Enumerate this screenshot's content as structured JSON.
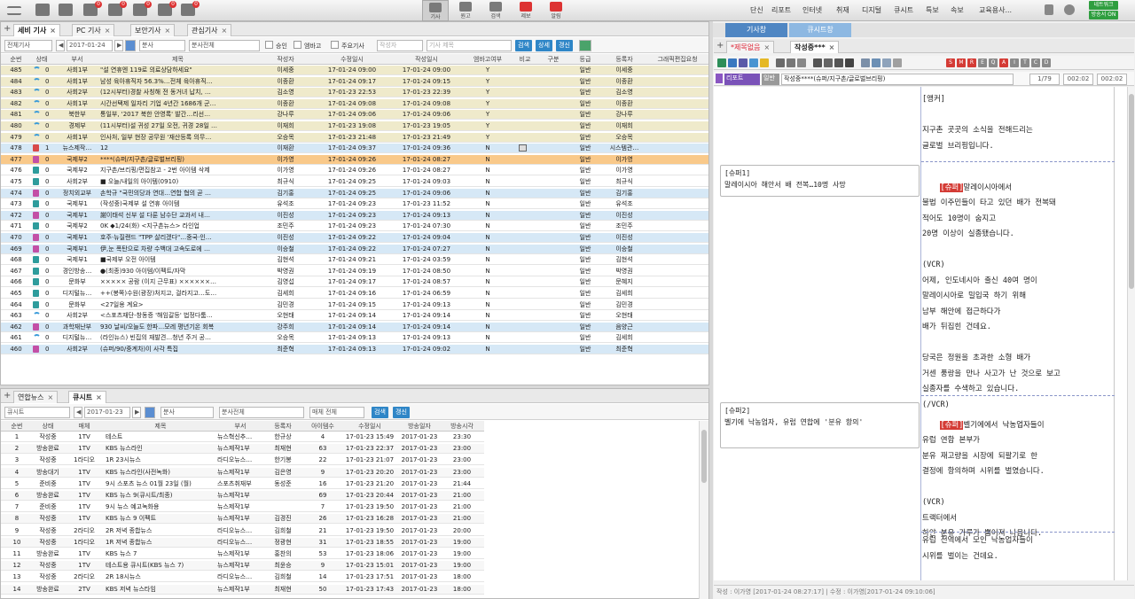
{
  "topbar": {
    "buttons": [
      {
        "icon": "program-icon",
        "label": "기사"
      },
      {
        "icon": "edit-icon",
        "label": "원고"
      },
      {
        "icon": "search-icon",
        "label": "검색"
      },
      {
        "icon": "alert-icon",
        "label": "제보",
        "badge": "0"
      },
      {
        "icon": "message-icon",
        "label": "알림",
        "badge": "0"
      }
    ],
    "left_badges": [
      "0",
      "0",
      "0",
      "0",
      "0"
    ],
    "menu": [
      "단신",
      "리포트",
      "인터넷",
      "취재",
      "디지털",
      "큐시트",
      "특보",
      "속보",
      "교육용사..."
    ],
    "status": [
      "네트워크 ON",
      "방송서 ON"
    ]
  },
  "left_top": {
    "tabs": [
      {
        "label": "세비 기사",
        "active": true
      },
      {
        "label": "PC 기사"
      },
      {
        "label": "보안기사"
      },
      {
        "label": "관심기사"
      }
    ],
    "filters": {
      "type": "전체기사",
      "date": "2017-01-24",
      "dept": "분사",
      "dept_all": "분사전체",
      "check_approved": "승인",
      "check_embargo": "엠바고",
      "check_main": "주요기사",
      "writer_placeholder": "작성자",
      "title_placeholder": "기사 제목",
      "btn_search": "검색",
      "btn_detail": "상세",
      "btn_refresh": "갱신"
    },
    "columns": [
      "순번",
      "상태",
      "부서",
      "제목",
      "작성자",
      "수정일시",
      "작성일시",
      "엠바고여부",
      "비교",
      "구분",
      "등급",
      "등록자",
      "그래픽편집요청"
    ],
    "rows": [
      {
        "no": "485",
        "status": "0",
        "dept": "사회1부",
        "title": "\"설 연휴엔 119로 의료상담하세요\"",
        "writer": "이세중",
        "mod": "17-01-24 09:00",
        "created": "17-01-24 09:00",
        "embargo": "Y",
        "grade": "일반",
        "reg": "이세중",
        "color": "yellow",
        "icon": "wifi"
      },
      {
        "no": "484",
        "status": "0",
        "dept": "사회1부",
        "title": "남성 육아휴직자 56.3%…전체 육아휴직…",
        "writer": "이종환",
        "mod": "17-01-24 09:17",
        "created": "17-01-24 09:15",
        "embargo": "Y",
        "grade": "일반",
        "reg": "이종환",
        "color": "yellow",
        "icon": "wifi"
      },
      {
        "no": "483",
        "status": "0",
        "dept": "사회2부",
        "title": "(12시부터)경찰 사칭해 전 동거녀 납치, …",
        "writer": "김소영",
        "mod": "17-01-23 22:53",
        "created": "17-01-23 22:39",
        "embargo": "Y",
        "grade": "일반",
        "reg": "김소영",
        "color": "yellow",
        "icon": "wifi"
      },
      {
        "no": "482",
        "status": "0",
        "dept": "사회1부",
        "title": "시간선택제 일자리 기업 4년간 1686개 군…",
        "writer": "이종환",
        "mod": "17-01-24 09:08",
        "created": "17-01-24 09:08",
        "embargo": "Y",
        "grade": "일반",
        "reg": "이종환",
        "color": "yellow",
        "icon": "wifi"
      },
      {
        "no": "481",
        "status": "0",
        "dept": "북한부",
        "title": "통일부, '2017 북한 안영록' 발간…리선…",
        "writer": "강나루",
        "mod": "17-01-24 09:06",
        "created": "17-01-24 09:06",
        "embargo": "Y",
        "grade": "일반",
        "reg": "강나루",
        "color": "yellow",
        "icon": "wifi"
      },
      {
        "no": "480",
        "status": "0",
        "dept": "경제부",
        "title": "(11시부터)설 귀성 27일 오전, 귀경 28일 …",
        "writer": "이재희",
        "mod": "17-01-23 19:08",
        "created": "17-01-23 19:05",
        "embargo": "Y",
        "grade": "일반",
        "reg": "이재희",
        "color": "yellow",
        "icon": "wifi"
      },
      {
        "no": "479",
        "status": "0",
        "dept": "사회1부",
        "title": "인사처, 일부 현장 공무원 '재산등록 의무…",
        "writer": "오승목",
        "mod": "17-01-23 21:48",
        "created": "17-01-23 21:49",
        "embargo": "Y",
        "grade": "일반",
        "reg": "오승목",
        "color": "yellow",
        "icon": "wifi"
      },
      {
        "no": "478",
        "status": "1",
        "dept": "뉴스제작…",
        "title": "12",
        "writer": "이재환",
        "mod": "17-01-24 09:37",
        "created": "17-01-24 09:36",
        "embargo": "N",
        "grade": "일반",
        "reg": "시스템관…",
        "color": "blue",
        "icon": "doc-red"
      },
      {
        "no": "477",
        "status": "0",
        "dept": "국제부2",
        "title": "****(슈퍼/지구촌/글로벌브리핑)",
        "writer": "이가영",
        "mod": "17-01-24 09:26",
        "created": "17-01-24 08:27",
        "embargo": "N",
        "grade": "일반",
        "reg": "이가영",
        "color": "orange",
        "icon": "doc-pink"
      },
      {
        "no": "476",
        "status": "0",
        "dept": "국제부2",
        "title": "지구촌/브리핑/편집참고 - 2번 아이템 삭제",
        "writer": "이가영",
        "mod": "17-01-24 09:26",
        "created": "17-01-24 08:27",
        "embargo": "N",
        "grade": "일반",
        "reg": "이가영",
        "color": "white",
        "icon": "doc-teal"
      },
      {
        "no": "475",
        "status": "0",
        "dept": "사회2부",
        "title": "■ 오늘/내일의 아이템(0910)",
        "writer": "최규식",
        "mod": "17-01-24 09:25",
        "created": "17-01-24 09:03",
        "embargo": "N",
        "grade": "일반",
        "reg": "최규식",
        "color": "white",
        "icon": "doc-teal"
      },
      {
        "no": "474",
        "status": "0",
        "dept": "정치외교부",
        "title": "손학규 \"국민의당과 연대…연합 협의 곧 …",
        "writer": "김기홍",
        "mod": "17-01-24 09:25",
        "created": "17-01-24 09:06",
        "embargo": "N",
        "grade": "일반",
        "reg": "김기홍",
        "color": "blue",
        "icon": "doc-pink"
      },
      {
        "no": "473",
        "status": "0",
        "dept": "국제부1",
        "title": "(작성중)국제부 설 연휴 아이템",
        "writer": "유석조",
        "mod": "17-01-24 09:23",
        "created": "17-01-23 11:52",
        "embargo": "N",
        "grade": "일반",
        "reg": "유석조",
        "color": "white",
        "icon": "doc-teal"
      },
      {
        "no": "472",
        "status": "0",
        "dept": "국제부1",
        "title": "謝이태석 신부 설 다룬 남수단 교과서 내…",
        "writer": "이진성",
        "mod": "17-01-24 09:23",
        "created": "17-01-24 09:13",
        "embargo": "N",
        "grade": "일반",
        "reg": "이진성",
        "color": "blue",
        "icon": "doc-pink"
      },
      {
        "no": "471",
        "status": "0",
        "dept": "국제부2",
        "title": "0K ◆1/24(화) <지구촌뉴스> 라인업",
        "writer": "조민주",
        "mod": "17-01-24 09:23",
        "created": "17-01-24 07:30",
        "embargo": "N",
        "grade": "일반",
        "reg": "조민주",
        "color": "white",
        "icon": "doc-teal"
      },
      {
        "no": "470",
        "status": "0",
        "dept": "국제부1",
        "title": "호주·뉴질랜드 \"TPP 살리겠다\"…중국·인…",
        "writer": "이진성",
        "mod": "17-01-24 09:22",
        "created": "17-01-24 09:04",
        "embargo": "N",
        "grade": "일반",
        "reg": "이진성",
        "color": "blue",
        "icon": "doc-pink"
      },
      {
        "no": "469",
        "status": "0",
        "dept": "국제부1",
        "title": "伊,눈 폭탄으로 차량 수백대 고속도로에 …",
        "writer": "이승철",
        "mod": "17-01-24 09:22",
        "created": "17-01-24 07:27",
        "embargo": "N",
        "grade": "일반",
        "reg": "이승철",
        "color": "blue",
        "icon": "doc-pink"
      },
      {
        "no": "468",
        "status": "0",
        "dept": "국제부1",
        "title": "■국제부 오전 아이템",
        "writer": "김현석",
        "mod": "17-01-24 09:21",
        "created": "17-01-24 03:59",
        "embargo": "N",
        "grade": "일반",
        "reg": "김현석",
        "color": "white",
        "icon": "doc-teal"
      },
      {
        "no": "467",
        "status": "0",
        "dept": "경인방송…",
        "title": "●(최종)930 아이템/이펙트/자막",
        "writer": "박영권",
        "mod": "17-01-24 09:19",
        "created": "17-01-24 08:50",
        "embargo": "N",
        "grade": "일반",
        "reg": "박영권",
        "color": "white",
        "icon": "doc-teal"
      },
      {
        "no": "466",
        "status": "0",
        "dept": "문화부",
        "title": "××××× 공람 (이지 근무표) ××××××…",
        "writer": "김영섭",
        "mod": "17-01-24 09:17",
        "created": "17-01-24 08:57",
        "embargo": "N",
        "grade": "일반",
        "reg": "문혜지",
        "color": "white",
        "icon": "doc-teal"
      },
      {
        "no": "465",
        "status": "0",
        "dept": "디지털뉴…",
        "title": "++(봉쪽)수원(광장)처지고, 걸라지고…도…",
        "writer": "김세희",
        "mod": "17-01-24 09:16",
        "created": "17-01-24 06:59",
        "embargo": "N",
        "grade": "일반",
        "reg": "김세희",
        "color": "white",
        "icon": "doc-teal"
      },
      {
        "no": "464",
        "status": "0",
        "dept": "문화부",
        "title": "<27일용 계요>",
        "writer": "김민경",
        "mod": "17-01-24 09:15",
        "created": "17-01-24 09:13",
        "embargo": "N",
        "grade": "일반",
        "reg": "김민경",
        "color": "white",
        "icon": "doc-teal"
      },
      {
        "no": "463",
        "status": "0",
        "dept": "사회2부",
        "title": "<스포츠재단-창동증 '해임갈등' 법정다툼…",
        "writer": "오현태",
        "mod": "17-01-24 09:14",
        "created": "17-01-24 09:14",
        "embargo": "N",
        "grade": "일반",
        "reg": "오현태",
        "color": "white",
        "icon": "wifi"
      },
      {
        "no": "462",
        "status": "0",
        "dept": "과학재난부",
        "title": "930 날씨/오늘도 한파…모레 평년기온 회복",
        "writer": "강주희",
        "mod": "17-01-24 09:14",
        "created": "17-01-24 09:14",
        "embargo": "N",
        "grade": "일반",
        "reg": "음양근",
        "color": "blue",
        "icon": "doc-pink"
      },
      {
        "no": "461",
        "status": "0",
        "dept": "디지털뉴…",
        "title": "(라인뉴스) 빈집의 재발견…청년 주거 공…",
        "writer": "오승목",
        "mod": "17-01-24 09:13",
        "created": "17-01-24 09:13",
        "embargo": "N",
        "grade": "일반",
        "reg": "김세희",
        "color": "white",
        "icon": "wifi"
      },
      {
        "no": "460",
        "status": "0",
        "dept": "사회2부",
        "title": "(슈퍼/90/중계차)이 사각 특집",
        "writer": "최준혁",
        "mod": "17-01-24 09:13",
        "created": "17-01-24 09:02",
        "embargo": "N",
        "grade": "일반",
        "reg": "최준혁",
        "color": "blue",
        "icon": "doc-pink"
      }
    ]
  },
  "left_bottom": {
    "tabs": [
      {
        "label": "연합뉴스"
      },
      {
        "label": "큐시트",
        "active": true
      }
    ],
    "filters": {
      "type": "큐시트",
      "date": "2017-01-23",
      "dept": "분사",
      "dept_all": "분사전체",
      "media": "매체 전체",
      "btn_search": "검색",
      "btn_refresh": "갱신"
    },
    "columns": [
      "순번",
      "상태",
      "매체",
      "제목",
      "부서",
      "등록자",
      "아이템수",
      "수정일시",
      "방송일자",
      "방송시각"
    ],
    "rows": [
      {
        "no": "1",
        "status": "작성중",
        "media": "1TV",
        "title": "테스트",
        "dept": "뉴스혁신추…",
        "reg": "한규상",
        "items": "4",
        "mod": "17-01-23 15:49",
        "date": "2017-01-23",
        "time": "23:30"
      },
      {
        "no": "2",
        "status": "방송완료",
        "media": "1TV",
        "title": "KBS 뉴스라인",
        "dept": "뉴스제작1부",
        "reg": "최재현",
        "items": "63",
        "mod": "17-01-23 22:37",
        "date": "2017-01-23",
        "time": "23:00"
      },
      {
        "no": "3",
        "status": "작성중",
        "media": "1라디오",
        "title": "1R 23시뉴스",
        "dept": "라디오뉴스…",
        "reg": "한기봉",
        "items": "22",
        "mod": "17-01-23 21:07",
        "date": "2017-01-23",
        "time": "23:00"
      },
      {
        "no": "4",
        "status": "방송대기",
        "media": "1TV",
        "title": "KBS 뉴스라인(사전녹화)",
        "dept": "뉴스제작1부",
        "reg": "김은영",
        "items": "9",
        "mod": "17-01-23 20:20",
        "date": "2017-01-23",
        "time": "23:00"
      },
      {
        "no": "5",
        "status": "준비중",
        "media": "1TV",
        "title": "9시 스포츠 뉴스 01월 23일 (월)",
        "dept": "스포츠취재부",
        "reg": "동성준",
        "items": "16",
        "mod": "17-01-23 21:20",
        "date": "2017-01-23",
        "time": "21:44"
      },
      {
        "no": "6",
        "status": "방송완료",
        "media": "1TV",
        "title": "KBS 뉴스 9(큐시트/최종)",
        "dept": "뉴스제작1부",
        "reg": "",
        "items": "69",
        "mod": "17-01-23 20:44",
        "date": "2017-01-23",
        "time": "21:00"
      },
      {
        "no": "7",
        "status": "준비중",
        "media": "1TV",
        "title": "9시 뉴스 예고녹화용",
        "dept": "뉴스제작1부",
        "reg": "",
        "items": "7",
        "mod": "17-01-23 19:50",
        "date": "2017-01-23",
        "time": "21:00"
      },
      {
        "no": "8",
        "status": "작성중",
        "media": "1TV",
        "title": "KBS 뉴스 9 이펙트",
        "dept": "뉴스제작1부",
        "reg": "김경진",
        "items": "26",
        "mod": "17-01-23 16:28",
        "date": "2017-01-23",
        "time": "21:00"
      },
      {
        "no": "9",
        "status": "작성중",
        "media": "2라디오",
        "title": "2R 저녁 종합뉴스",
        "dept": "라디오뉴스…",
        "reg": "김희철",
        "items": "21",
        "mod": "17-01-23 19:50",
        "date": "2017-01-23",
        "time": "20:00"
      },
      {
        "no": "10",
        "status": "작성중",
        "media": "1라디오",
        "title": "1R 저녁 종합뉴스",
        "dept": "라디오뉴스…",
        "reg": "정광현",
        "items": "31",
        "mod": "17-01-23 18:55",
        "date": "2017-01-23",
        "time": "19:00"
      },
      {
        "no": "11",
        "status": "방송완료",
        "media": "1TV",
        "title": "KBS 뉴스 7",
        "dept": "뉴스제작1부",
        "reg": "홍찬의",
        "items": "53",
        "mod": "17-01-23 18:06",
        "date": "2017-01-23",
        "time": "19:00"
      },
      {
        "no": "12",
        "status": "작성중",
        "media": "1TV",
        "title": "테스트용 큐시트(KBS 뉴스 7)",
        "dept": "뉴스제작1부",
        "reg": "최윤승",
        "items": "9",
        "mod": "17-01-23 15:01",
        "date": "2017-01-23",
        "time": "19:00"
      },
      {
        "no": "13",
        "status": "작성중",
        "media": "2라디오",
        "title": "2R 18시뉴스",
        "dept": "라디오뉴스…",
        "reg": "김희철",
        "items": "14",
        "mod": "17-01-23 17:51",
        "date": "2017-01-23",
        "time": "18:00"
      },
      {
        "no": "14",
        "status": "방송완료",
        "media": "2TV",
        "title": "KBS 저녁 뉴스타임",
        "dept": "뉴스제작1부",
        "reg": "최재현",
        "items": "50",
        "mod": "17-01-23 17:43",
        "date": "2017-01-23",
        "time": "18:00"
      }
    ]
  },
  "right": {
    "tabs": [
      "기사창",
      "큐시트창"
    ],
    "doc_tabs": [
      {
        "label": "*제목없음"
      },
      {
        "label": "작성중***",
        "active": true
      }
    ],
    "toolbar_letters": [
      "S",
      "M",
      "R",
      "E",
      "Q",
      "A",
      "I",
      "T",
      "C",
      "D"
    ],
    "info": {
      "type": "리포트",
      "grade": "일반",
      "title": "작성중****(슈퍼/지구촌/글로벌브리핑)",
      "page": "1/79",
      "dur1": "002:02",
      "dur2": "002:02"
    },
    "cues": [
      {
        "text": "[슈퍼1]\n말레이시아 해안서 배 전복…10명 사망"
      },
      {
        "text": "[슈퍼2]\n벨기에 낙농업자, 유럽 연합에 '분유 항의'"
      }
    ],
    "body": {
      "block1": "[앵커]\n\n지구촌 곳곳의 소식을 전해드리는\n글로벌 브리핑입니다.",
      "block2_prefix": "[슈퍼]",
      "block2": "말레이시아에서\n불법 이주민들이 타고 있던 배가 전복돼\n적어도 10명이 숨지고\n20명 이상이 실종됐습니다.\n\n(VCR)\n어제, 인도네시아 출신 40여 명이\n말레이시아로 밀입국 하기 위해\n남부 해안에 접근하다가\n배가 뒤집힌 건데요.\n\n당국은 정원을 초과한 소형 배가\n거센 풍랑을 만나 사고가 난 것으로 보고\n실종자를 수색하고 있습니다.\n(/VCR)",
      "block3_prefix": "[슈퍼]",
      "block3": "벨기에에서 낙농업자들이\n유럽 연합 본부가\n분유 재고량을 시장에 되팔기로 한\n결정에 항의하며 시위를 벌였습니다.\n\n(VCR)\n트랙터에서\n하얀 분유 가루가 뿜어져 나옵니다.",
      "block4": "유럽 전역에서 모인 낙농업자들이\n시위를 벌이는 건데요."
    },
    "footer": "작성 : 이가영 [2017-01-24 08:27:17]  |  수정 : 이가영[2017-01-24 09:10:06]"
  },
  "colors": {
    "accent": "#2f86c7",
    "tab_blue": "#5a8fc8",
    "tab_lightblue": "#8ab6e0",
    "status_green": "#2f9e3f",
    "super_red": "#d43b35"
  }
}
